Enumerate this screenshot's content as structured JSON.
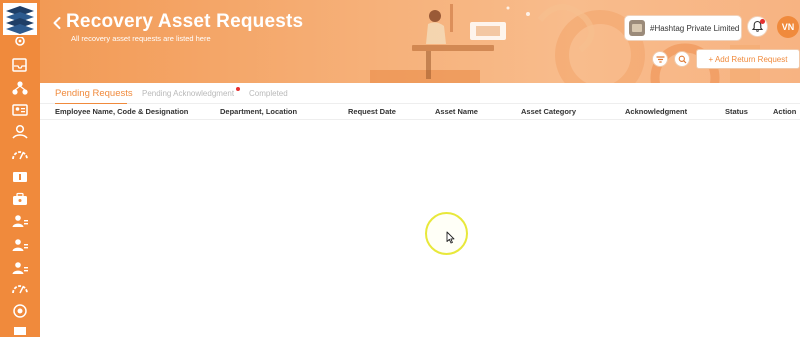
{
  "header": {
    "title": "Recovery Asset Requests",
    "subtitle": "All recovery asset requests are listed here",
    "company": "#Hashtag Private Limited",
    "avatar_initials": "VN",
    "add_button": "+ Add Return Request"
  },
  "tabs": [
    {
      "label": "Pending Requests",
      "active": true
    },
    {
      "label": "Pending Acknowledgment",
      "has_notification": true
    },
    {
      "label": "Completed"
    }
  ],
  "table": {
    "columns": [
      "Employee Name, Code & Designation",
      "Department, Location",
      "Request Date",
      "Asset Name",
      "Asset Category",
      "Acknowledgment",
      "Status",
      "Action"
    ],
    "rows": []
  },
  "sidebar": {
    "icons": [
      "settings-icon",
      "inbox-icon",
      "network-icon",
      "id-card-icon",
      "hand-heart-icon",
      "gauge-icon",
      "payroll-icon",
      "briefcase-icon",
      "user-group-icon",
      "user-group-icon",
      "user-group-icon",
      "gauge-icon",
      "target-icon",
      "monitor-icon"
    ]
  },
  "colors": {
    "accent": "#f08a3c",
    "notification": "#e63030",
    "cursor_highlight": "#e8e83a"
  }
}
